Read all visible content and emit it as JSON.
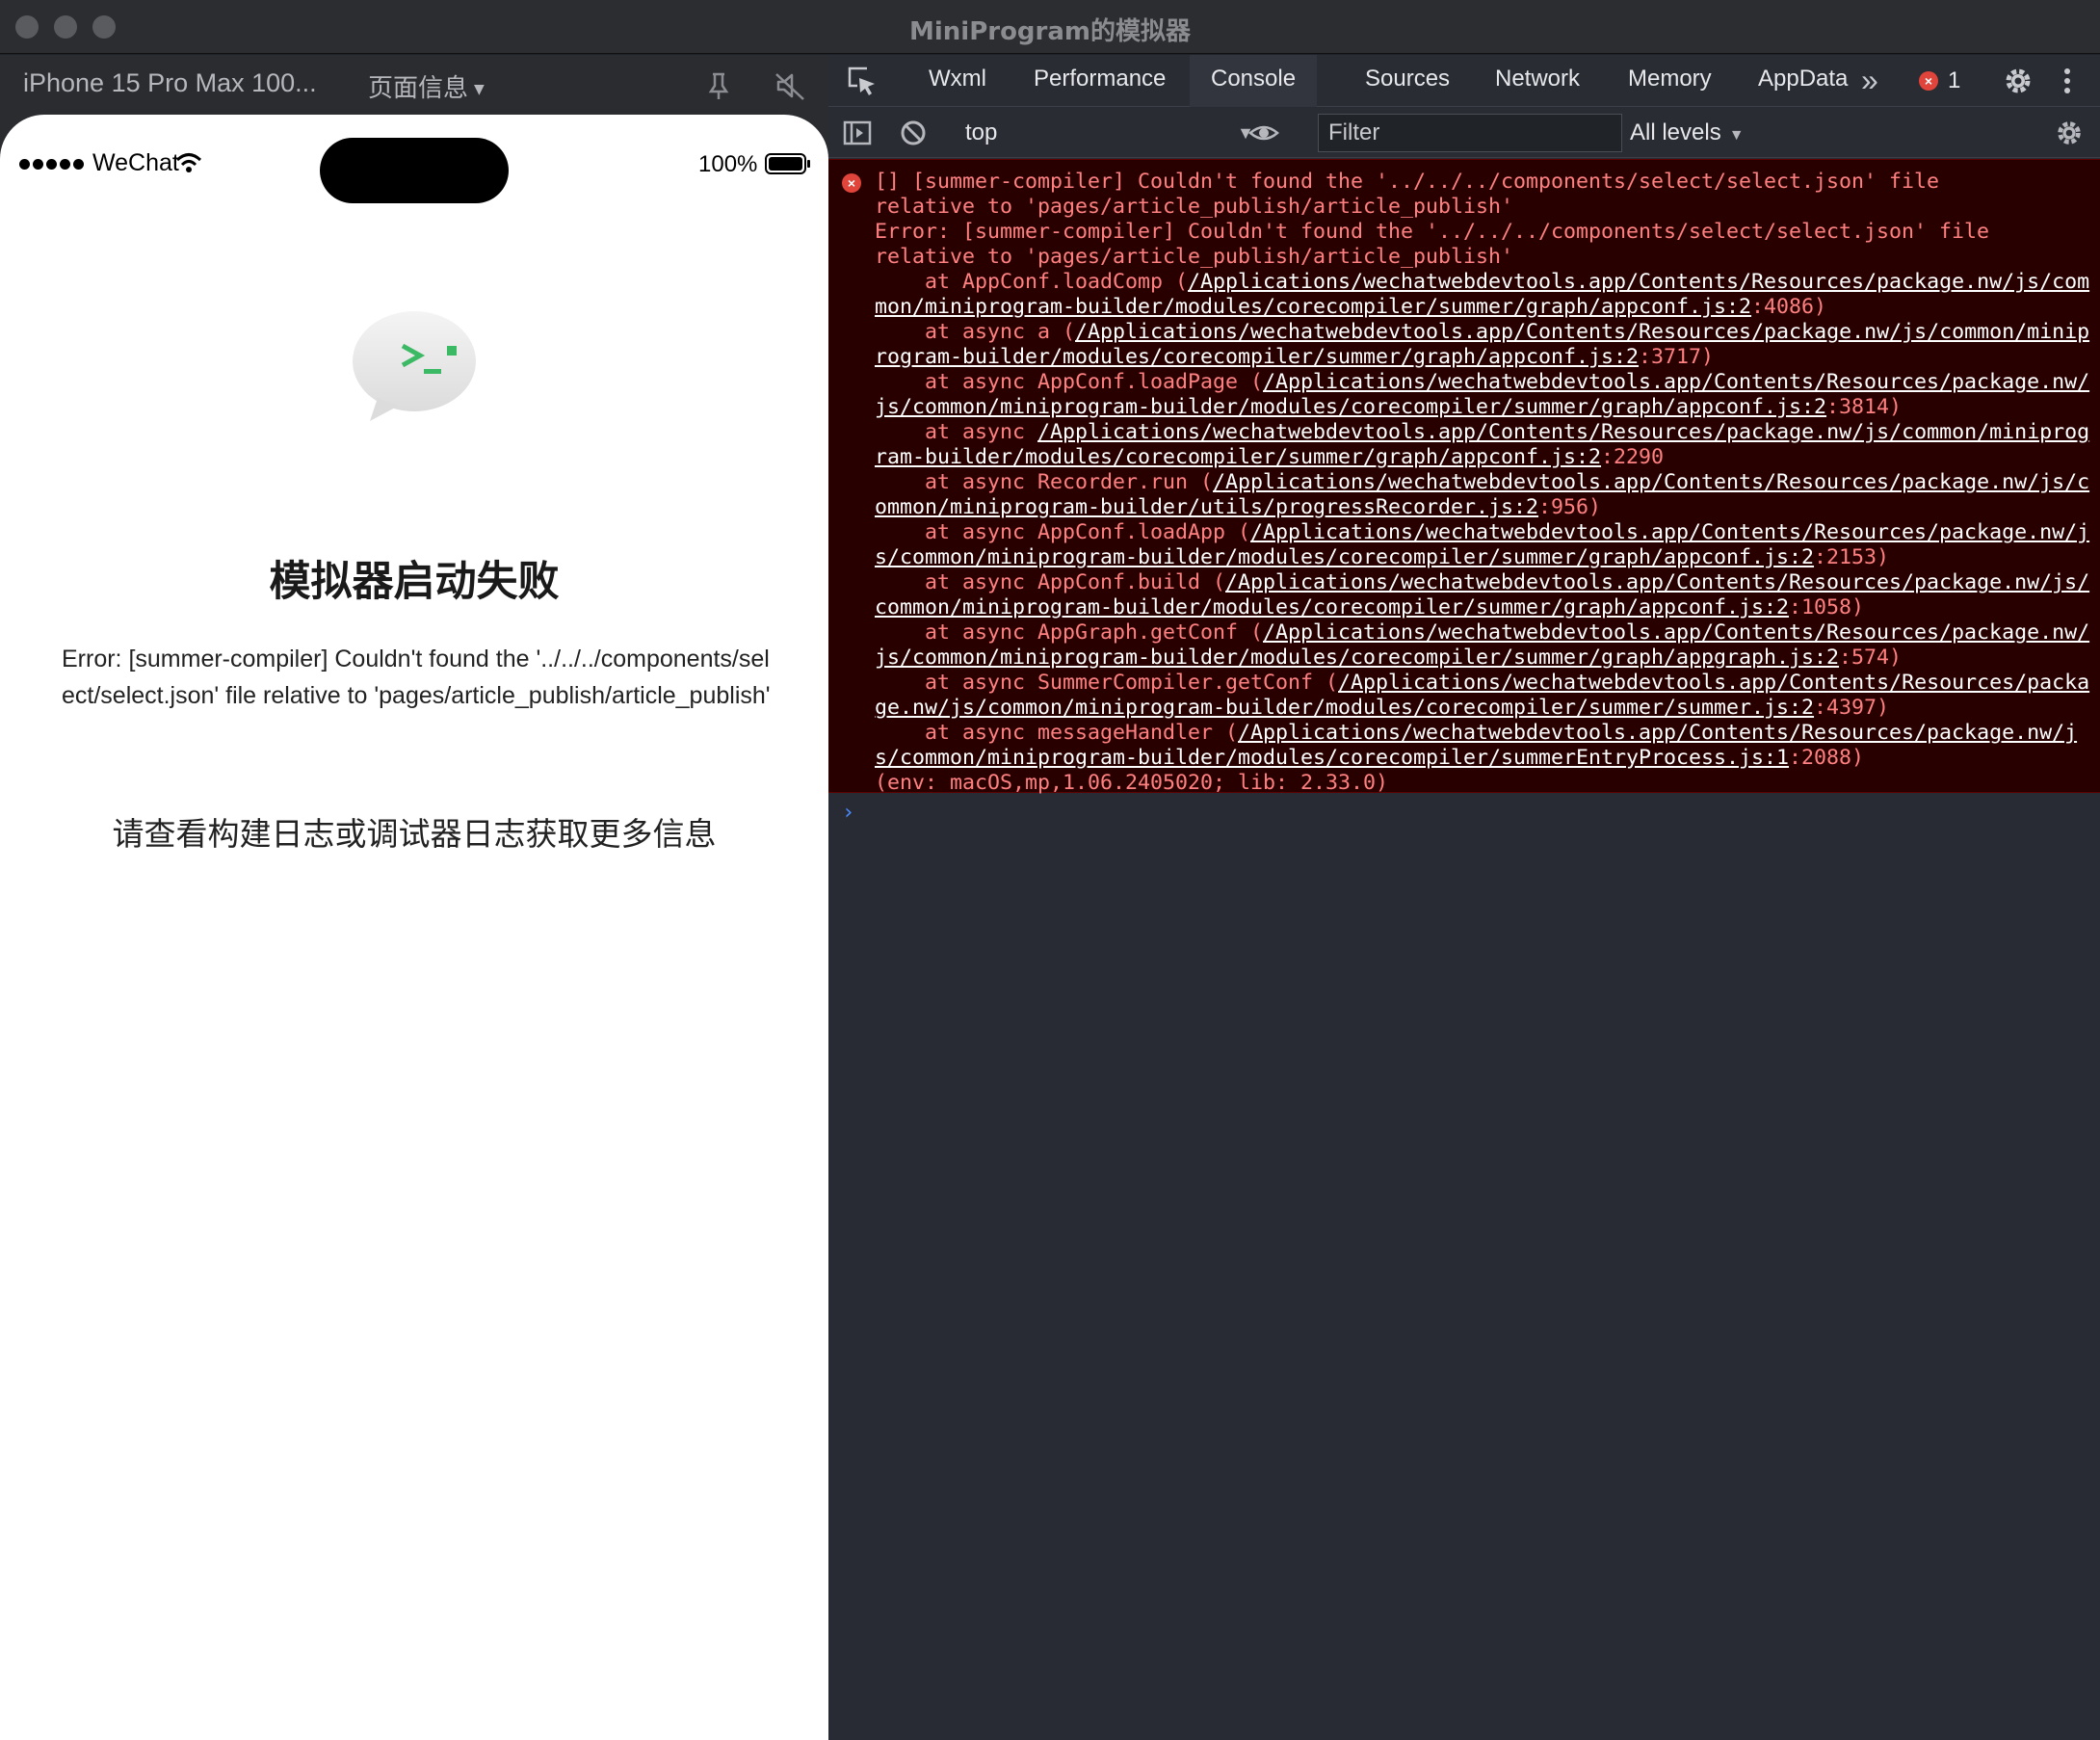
{
  "window": {
    "title": "MiniProgram的模拟器",
    "control_color": "#5a5b5f"
  },
  "simulator": {
    "device_label": "iPhone 15 Pro Max 100...",
    "page_info_label": "页面信息",
    "status_bar": {
      "carrier": "WeChat",
      "battery": "100%"
    },
    "fail_title": "模拟器启动失败",
    "error_text": "Error: [summer-compiler] Couldn't found the '../../../components/select/select.json' file relative to 'pages/article_publish/article_publish'",
    "hint": "请查看构建日志或调试器日志获取更多信息",
    "accent_color": "#3cb964"
  },
  "devtools": {
    "tabs": [
      {
        "label": "Wxml"
      },
      {
        "label": "Performance"
      },
      {
        "label": "Console"
      },
      {
        "label": "Sources"
      },
      {
        "label": "Network"
      },
      {
        "label": "Memory"
      },
      {
        "label": "AppData"
      }
    ],
    "more_label": "»",
    "error_count": "1",
    "console_bar": {
      "context": "top",
      "filter_placeholder": "Filter",
      "levels": "All levels"
    },
    "log": {
      "header_line1": "[] [summer-compiler] Couldn't found the '../../../components/select/select.json' file",
      "header_line2": "relative to 'pages/article_publish/article_publish'",
      "error_line1": "Error: [summer-compiler] Couldn't found the '../../../components/select/select.json' file",
      "error_line2": "relative to 'pages/article_publish/article_publish'",
      "frames": [
        {
          "prefix": "    at AppConf.loadComp (",
          "link": "/Applications/wechatwebdevtools.app/Contents/Resources/package.nw/js/common/miniprogram-builder/modules/corecompiler/summer/graph/appconf.js:2",
          "suffix": ":4086)"
        },
        {
          "prefix": "    at async a (",
          "link": "/Applications/wechatwebdevtools.app/Contents/Resources/package.nw/js/common/miniprogram-builder/modules/corecompiler/summer/graph/appconf.js:2",
          "suffix": ":3717)"
        },
        {
          "prefix": "    at async AppConf.loadPage (",
          "link": "/Applications/wechatwebdevtools.app/Contents/Resources/package.nw/js/common/miniprogram-builder/modules/corecompiler/summer/graph/appconf.js:2",
          "suffix": ":3814)"
        },
        {
          "prefix": "    at async ",
          "link": "/Applications/wechatwebdevtools.app/Contents/Resources/package.nw/js/common/miniprogram-builder/modules/corecompiler/summer/graph/appconf.js:2",
          "suffix": ":2290"
        },
        {
          "prefix": "    at async Recorder.run (",
          "link": "/Applications/wechatwebdevtools.app/Contents/Resources/package.nw/js/common/miniprogram-builder/utils/progressRecorder.js:2",
          "suffix": ":956)"
        },
        {
          "prefix": "    at async AppConf.loadApp (",
          "link": "/Applications/wechatwebdevtools.app/Contents/Resources/package.nw/js/common/miniprogram-builder/modules/corecompiler/summer/graph/appconf.js:2",
          "suffix": ":2153)"
        },
        {
          "prefix": "    at async AppConf.build (",
          "link": "/Applications/wechatwebdevtools.app/Contents/Resources/package.nw/js/common/miniprogram-builder/modules/corecompiler/summer/graph/appconf.js:2",
          "suffix": ":1058)"
        },
        {
          "prefix": "    at async AppGraph.getConf (",
          "link": "/Applications/wechatwebdevtools.app/Contents/Resources/package.nw/js/common/miniprogram-builder/modules/corecompiler/summer/graph/appgraph.js:2",
          "suffix": ":574)"
        },
        {
          "prefix": "    at async SummerCompiler.getConf (",
          "link": "/Applications/wechatwebdevtools.app/Contents/Resources/package.nw/js/common/miniprogram-builder/modules/corecompiler/summer/summer.js:2",
          "suffix": ":4397)"
        },
        {
          "prefix": "    at async messageHandler (",
          "link": "/Applications/wechatwebdevtools.app/Contents/Resources/package.nw/js/common/miniprogram-builder/modules/corecompiler/summerEntryProcess.js:1",
          "suffix": ":2088)"
        }
      ],
      "env": "(env: macOS,mp,1.06.2405020; lib: 2.33.0)"
    },
    "prompt": "›",
    "colors": {
      "error_bg": "#290000",
      "error_text": "#ff8080",
      "error_badge": "#e0443a",
      "prompt": "#4a8cff"
    }
  }
}
